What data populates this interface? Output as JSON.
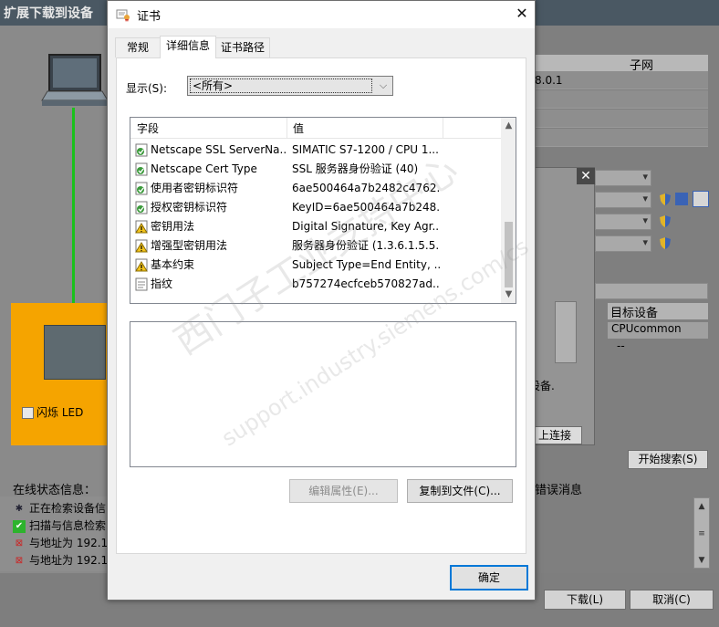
{
  "background": {
    "title": "扩展下载到设备",
    "flash_led_label": "闪烁 LED",
    "status_heading": "在线状态信息：",
    "status_lines": [
      "正在检索设备信",
      "扫描与信息检索",
      "与地址为 192.1",
      "与地址为 192.1"
    ],
    "subnet_header": "子网",
    "ip_fragment": "8.0.1",
    "target_device_header": "目标设备",
    "target_device_value": "CPUcommon",
    "target_device_dash": "--",
    "device_text": "设备.",
    "connect_button": "上连接",
    "search_button": "开始搜索(S)",
    "error_heading": "错误消息",
    "download_button": "下载(L)",
    "cancel_button": "取消(C)"
  },
  "dialog": {
    "title": "证书",
    "tabs": [
      "常规",
      "详细信息",
      "证书路径"
    ],
    "active_tab": "详细信息",
    "show_label": "显示(S):",
    "show_value": "<所有>",
    "columns": {
      "field": "字段",
      "value": "值"
    },
    "rows": [
      {
        "icon": "cert-field-icon",
        "field": "Netscape SSL ServerNa...",
        "value": "SIMATIC S7-1200 / CPU 1..."
      },
      {
        "icon": "cert-field-icon",
        "field": "Netscape Cert Type",
        "value": "SSL 服务器身份验证 (40)"
      },
      {
        "icon": "cert-field-icon",
        "field": "使用者密钥标识符",
        "value": "6ae500464a7b2482c4762..."
      },
      {
        "icon": "cert-field-icon",
        "field": "授权密钥标识符",
        "value": "KeyID=6ae500464a7b248..."
      },
      {
        "icon": "cert-warning-icon",
        "field": "密钥用法",
        "value": "Digital Signature, Key Agr..."
      },
      {
        "icon": "cert-warning-icon",
        "field": "增强型密钥用法",
        "value": "服务器身份验证 (1.3.6.1.5.5..."
      },
      {
        "icon": "cert-warning-icon",
        "field": "基本约束",
        "value": "Subject Type=End Entity, ..."
      },
      {
        "icon": "cert-property-icon",
        "field": "指纹",
        "value": "b757274ecfceb570827ad..."
      }
    ],
    "edit_button": "编辑属性(E)...",
    "copy_button": "复制到文件(C)...",
    "ok_button": "确定"
  },
  "watermark": {
    "cn": "西门子工业支持中心",
    "url": "support.industry.siemens.com/cs"
  }
}
